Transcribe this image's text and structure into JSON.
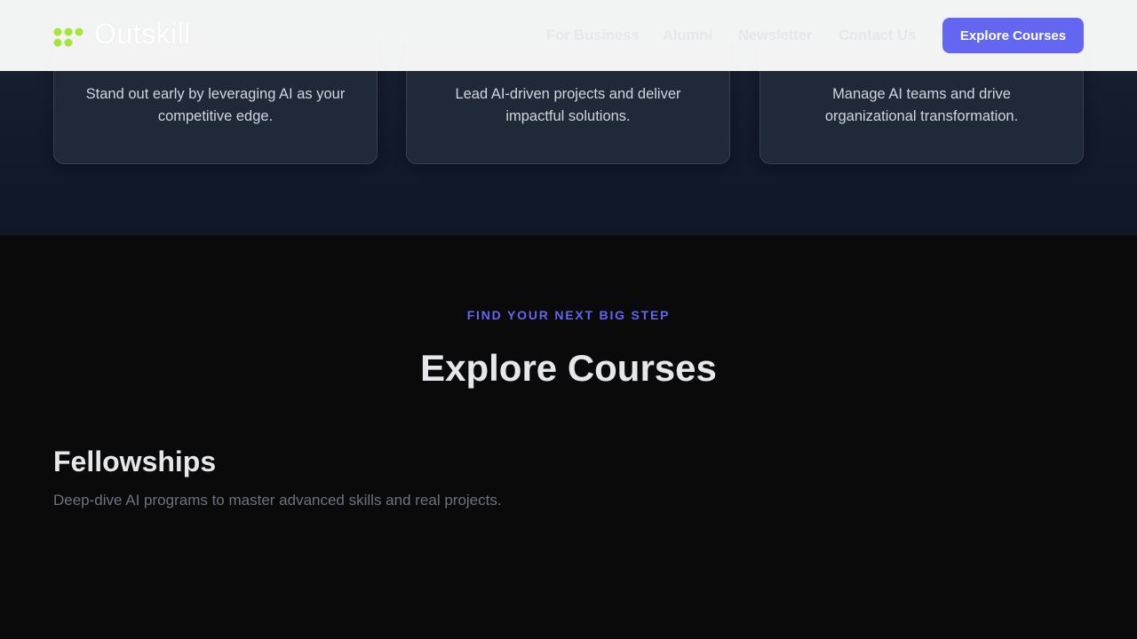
{
  "brand": {
    "name": "Outskill",
    "accent_color": "#a3e635"
  },
  "header": {
    "nav": [
      {
        "label": "For Business"
      },
      {
        "label": "Alumni"
      },
      {
        "label": "Newsletter"
      },
      {
        "label": "Contact Us"
      }
    ],
    "cta_label": "Explore Courses",
    "cta_color": "#6366f1"
  },
  "cards": [
    {
      "text": "Stand out early by leveraging AI as your competitive edge."
    },
    {
      "text": "Lead AI-driven projects and deliver impactful solutions."
    },
    {
      "text": "Manage AI teams and drive organizational transformation."
    }
  ],
  "courses_section": {
    "eyebrow": "FIND YOUR NEXT BIG STEP",
    "title": "Explore Courses",
    "category": {
      "title": "Fellowships",
      "description": "Deep-dive AI programs to master advanced skills and real projects."
    }
  }
}
